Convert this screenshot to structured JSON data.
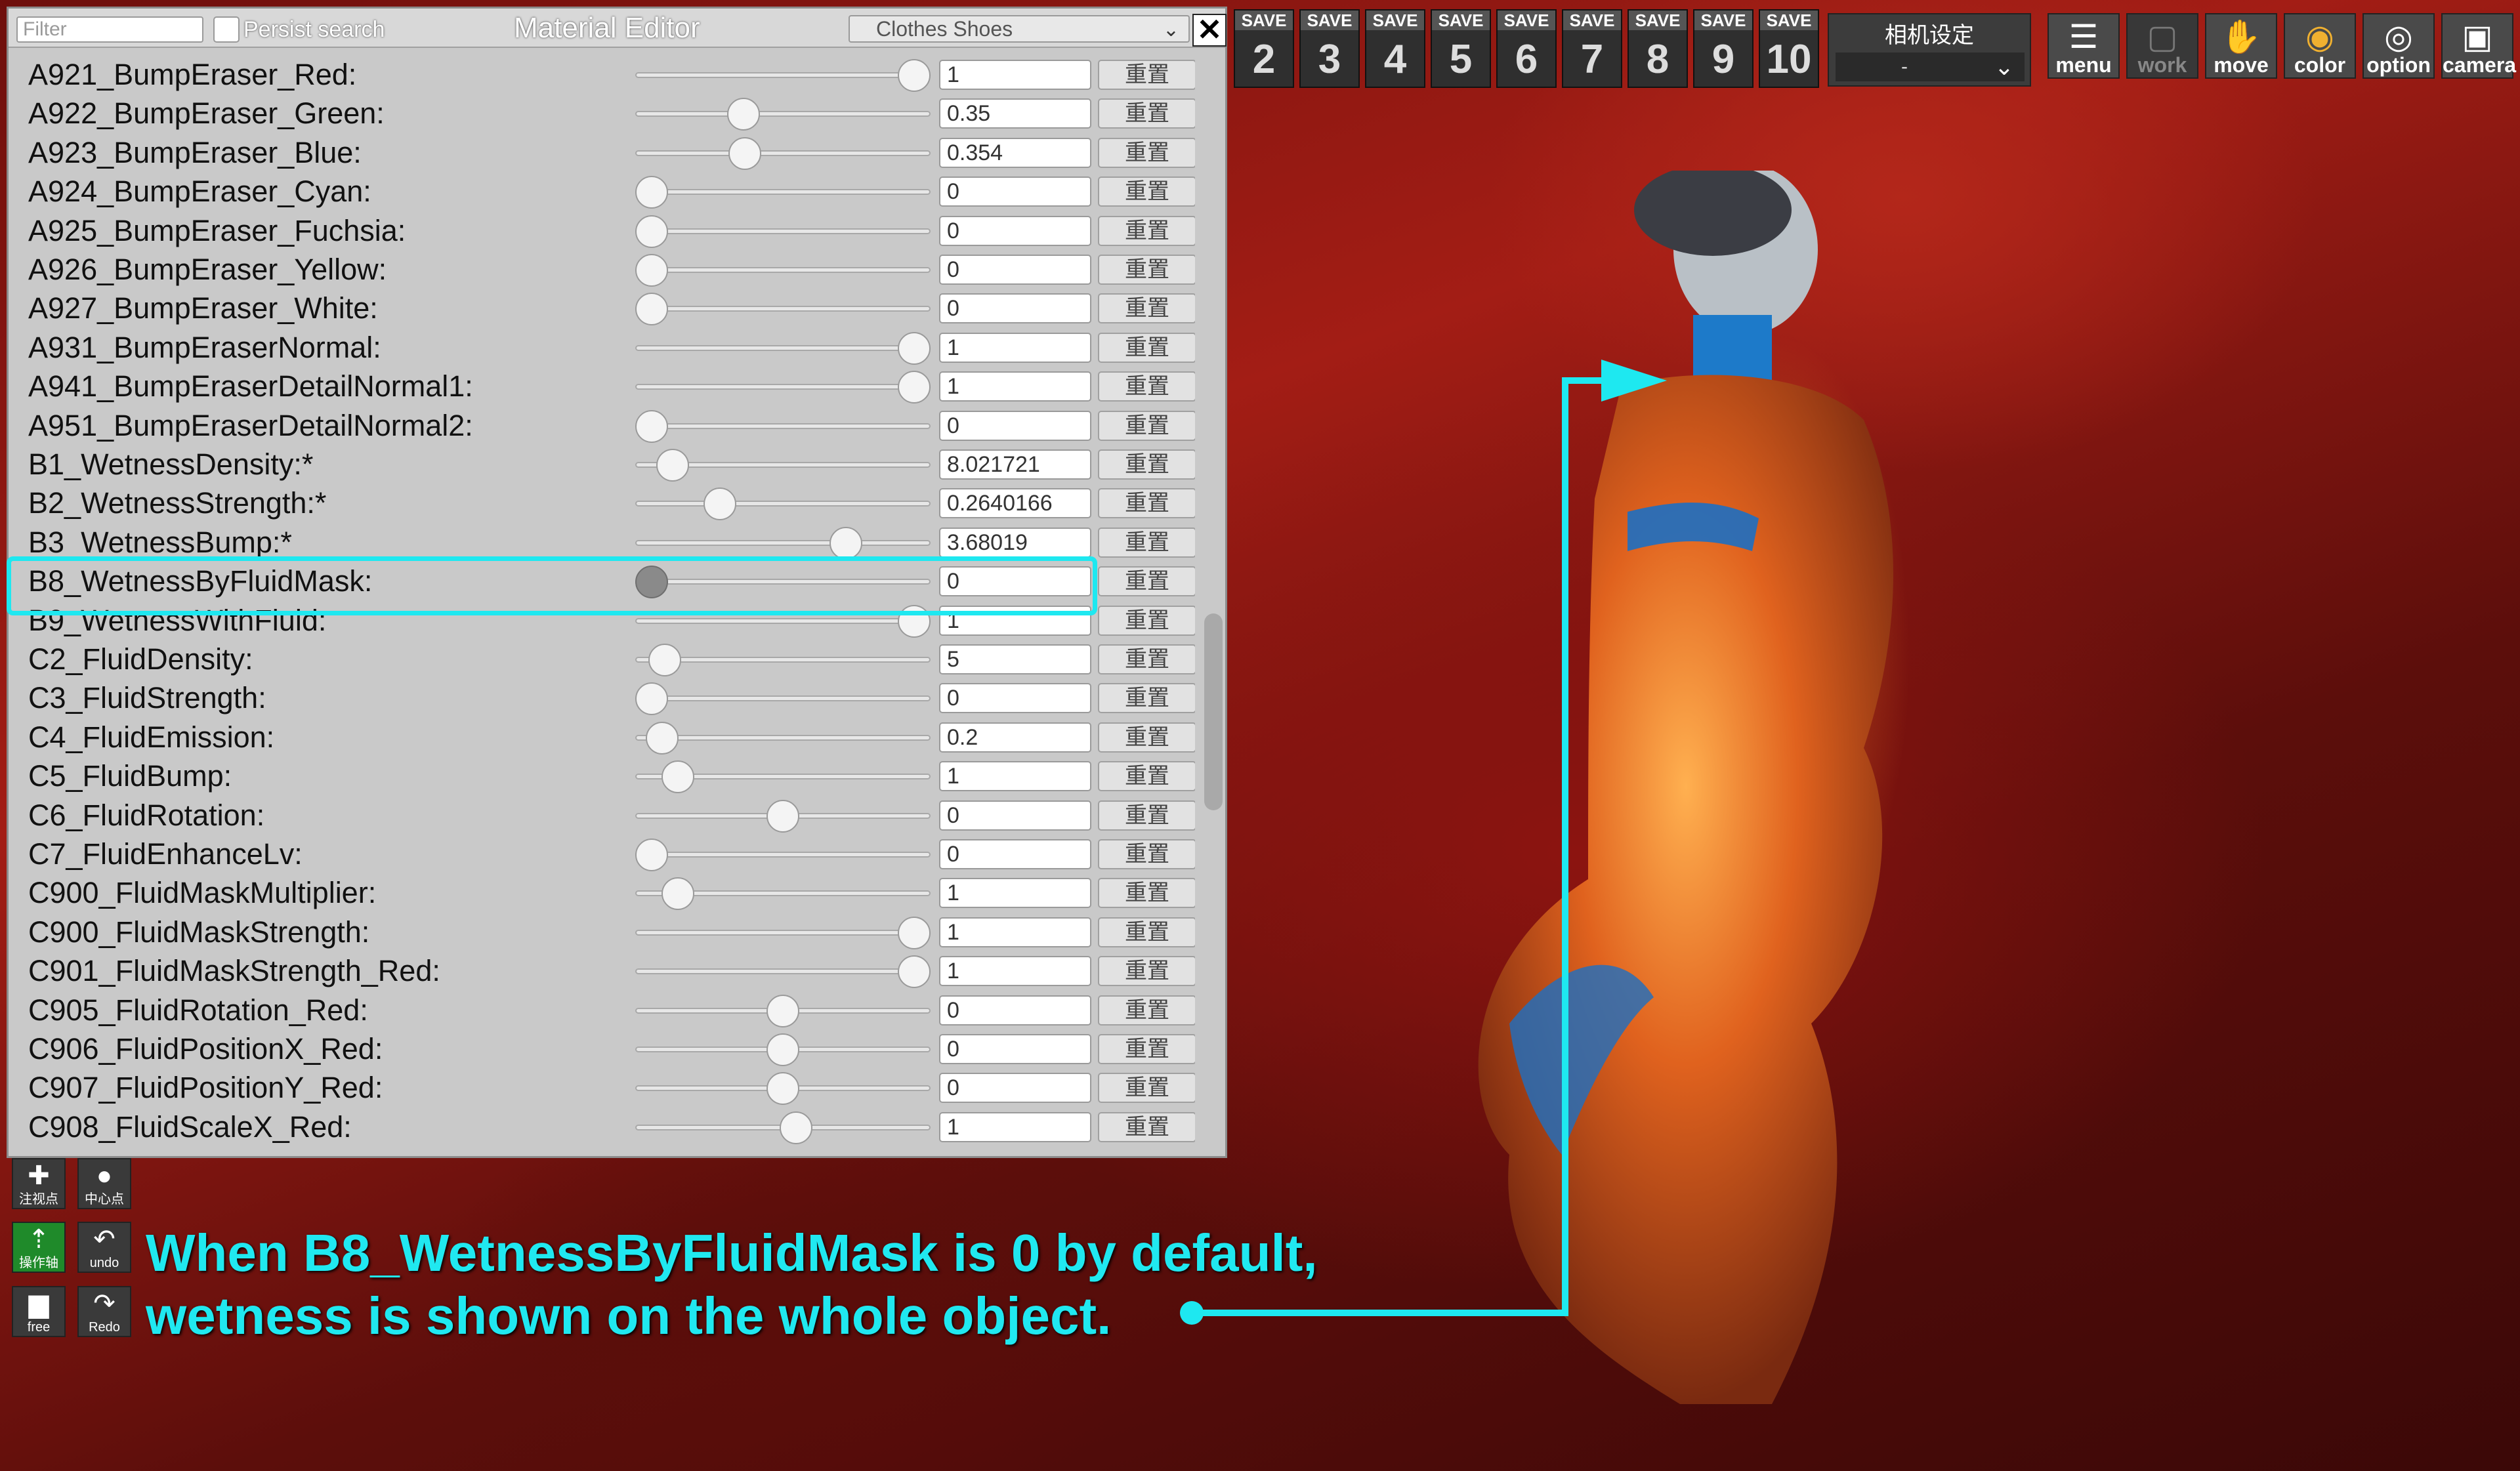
{
  "editor": {
    "filter_placeholder": "Filter",
    "persist_search_label": "Persist search",
    "title": "Material Editor",
    "dropdown_value": "Clothes Shoes",
    "close_label": "✕",
    "reset_label": "重置",
    "rows": [
      {
        "label": "A921_BumpEraser_Red:",
        "value": "1",
        "level": 1.0
      },
      {
        "label": "A922_BumpEraser_Green:",
        "value": "0.35",
        "level": 0.35
      },
      {
        "label": "A923_BumpEraser_Blue:",
        "value": "0.354",
        "level": 0.354
      },
      {
        "label": "A924_BumpEraser_Cyan:",
        "value": "0",
        "level": 0
      },
      {
        "label": "A925_BumpEraser_Fuchsia:",
        "value": "0",
        "level": 0
      },
      {
        "label": "A926_BumpEraser_Yellow:",
        "value": "0",
        "level": 0
      },
      {
        "label": "A927_BumpEraser_White:",
        "value": "0",
        "level": 0
      },
      {
        "label": "A931_BumpEraserNormal:",
        "value": "1",
        "level": 1.0
      },
      {
        "label": "A941_BumpEraserDetailNormal1:",
        "value": "1",
        "level": 1.0
      },
      {
        "label": "A951_BumpEraserDetailNormal2:",
        "value": "0",
        "level": 0
      },
      {
        "label": "B1_WetnessDensity:*",
        "value": "8.021721",
        "level": 0.08
      },
      {
        "label": "B2_WetnessStrength:*",
        "value": "0.2640166",
        "level": 0.26
      },
      {
        "label": "B3_WetnessBump:*",
        "value": "3.68019",
        "level": 0.74
      },
      {
        "label": "B8_WetnessByFluidMask:",
        "value": "0",
        "level": 0,
        "highlighted": true
      },
      {
        "label": "B9_WetnessWithFluid:",
        "value": "1",
        "level": 1.0
      },
      {
        "label": "C2_FluidDensity:",
        "value": "5",
        "level": 0.05
      },
      {
        "label": "C3_FluidStrength:",
        "value": "0",
        "level": 0
      },
      {
        "label": "C4_FluidEmission:",
        "value": "0.2",
        "level": 0.04
      },
      {
        "label": "C5_FluidBump:",
        "value": "1",
        "level": 0.1
      },
      {
        "label": "C6_FluidRotation:",
        "value": "0",
        "level": 0.5
      },
      {
        "label": "C7_FluidEnhanceLv:",
        "value": "0",
        "level": 0
      },
      {
        "label": "C900_FluidMaskMultiplier:",
        "value": "1",
        "level": 0.1
      },
      {
        "label": "C900_FluidMaskStrength:",
        "value": "1",
        "level": 1.0
      },
      {
        "label": "C901_FluidMaskStrength_Red:",
        "value": "1",
        "level": 1.0
      },
      {
        "label": "C905_FluidRotation_Red:",
        "value": "0",
        "level": 0.5
      },
      {
        "label": "C906_FluidPositionX_Red:",
        "value": "0",
        "level": 0.5
      },
      {
        "label": "C907_FluidPositionY_Red:",
        "value": "0",
        "level": 0.5
      },
      {
        "label": "C908_FluidScaleX_Red:",
        "value": "1",
        "level": 0.55
      }
    ]
  },
  "toolbar": {
    "save_label": "SAVE",
    "save_slots": [
      "2",
      "3",
      "4",
      "5",
      "6",
      "7",
      "8",
      "9",
      "10"
    ],
    "camera_settings_title": "相机设定",
    "camera_settings_value": "-",
    "menu_label": "menu",
    "work_label": "work",
    "move_label": "move",
    "color_label": "color",
    "option_label": "option",
    "camera_label": "camera"
  },
  "side_buttons": {
    "focus_label": "注视点",
    "center_label": "中心点",
    "operate_label": "操作轴",
    "undo_label": "undo",
    "free_label": "free",
    "redo_label": "Redo"
  },
  "annotation": {
    "line1": "When B8_WetnessByFluidMask is 0 by default,",
    "line2": "wetness is shown on the whole object.",
    "color": "#1ee8f0"
  }
}
